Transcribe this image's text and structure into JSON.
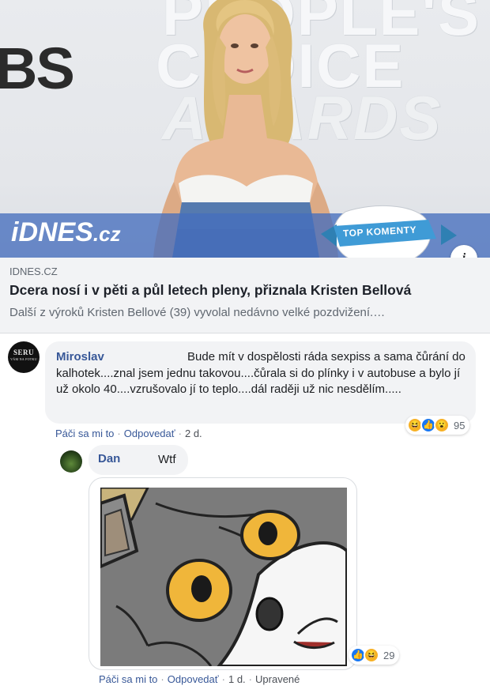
{
  "link_card": {
    "background_text_1": "PEOPLE'S",
    "background_text_2": "CHOICE",
    "background_text_3": "AWARDS",
    "background_partial_text": "BS",
    "brand_logo": "iDNES",
    "brand_logo_suffix": ".cz",
    "badge_label": "TOP KOMENTY",
    "info_icon_glyph": "i",
    "domain": "IDNES.CZ",
    "title": "Dcera nosí i v pěti a půl letech pleny, přiznala Kristen Bellová",
    "description": "Další z výroků Kristen Bellové (39) vyvolal nedávno velké pozdvižení.…"
  },
  "comments": [
    {
      "author": "Miroslav",
      "avatar_text_1": "SERU",
      "avatar_text_2": "VÁM NA FOTKU",
      "text": "Bude mít v dospělosti ráda sexpiss a sama čůrání do kalhotek....znal jsem jednu takovou....čůrala si do plínky i v autobuse a bylo jí už okolo 40....vzrušovalo jí to teplo....dál raději už nic nesdělím.....",
      "reaction_count": "95",
      "reactions": [
        "haha",
        "like",
        "wow"
      ],
      "actions": {
        "like": "Páči sa mi to",
        "reply": "Odpovedať",
        "time": "2 d."
      }
    },
    {
      "author": "Dan",
      "text": "Wtf",
      "attachment": "unsettled-tom-meme",
      "reaction_count": "29",
      "reactions": [
        "like",
        "haha"
      ],
      "actions": {
        "like": "Páči sa mi to",
        "reply": "Odpovedať",
        "time": "1 d.",
        "edited": "Upravené"
      }
    }
  ],
  "colors": {
    "link_blue": "#385898",
    "bubble_bg": "#f2f3f5",
    "brand_strip": "#466ebe",
    "meme_grey": "#7b7b7b",
    "meme_eye": "#f0b63a"
  },
  "separator": "·"
}
